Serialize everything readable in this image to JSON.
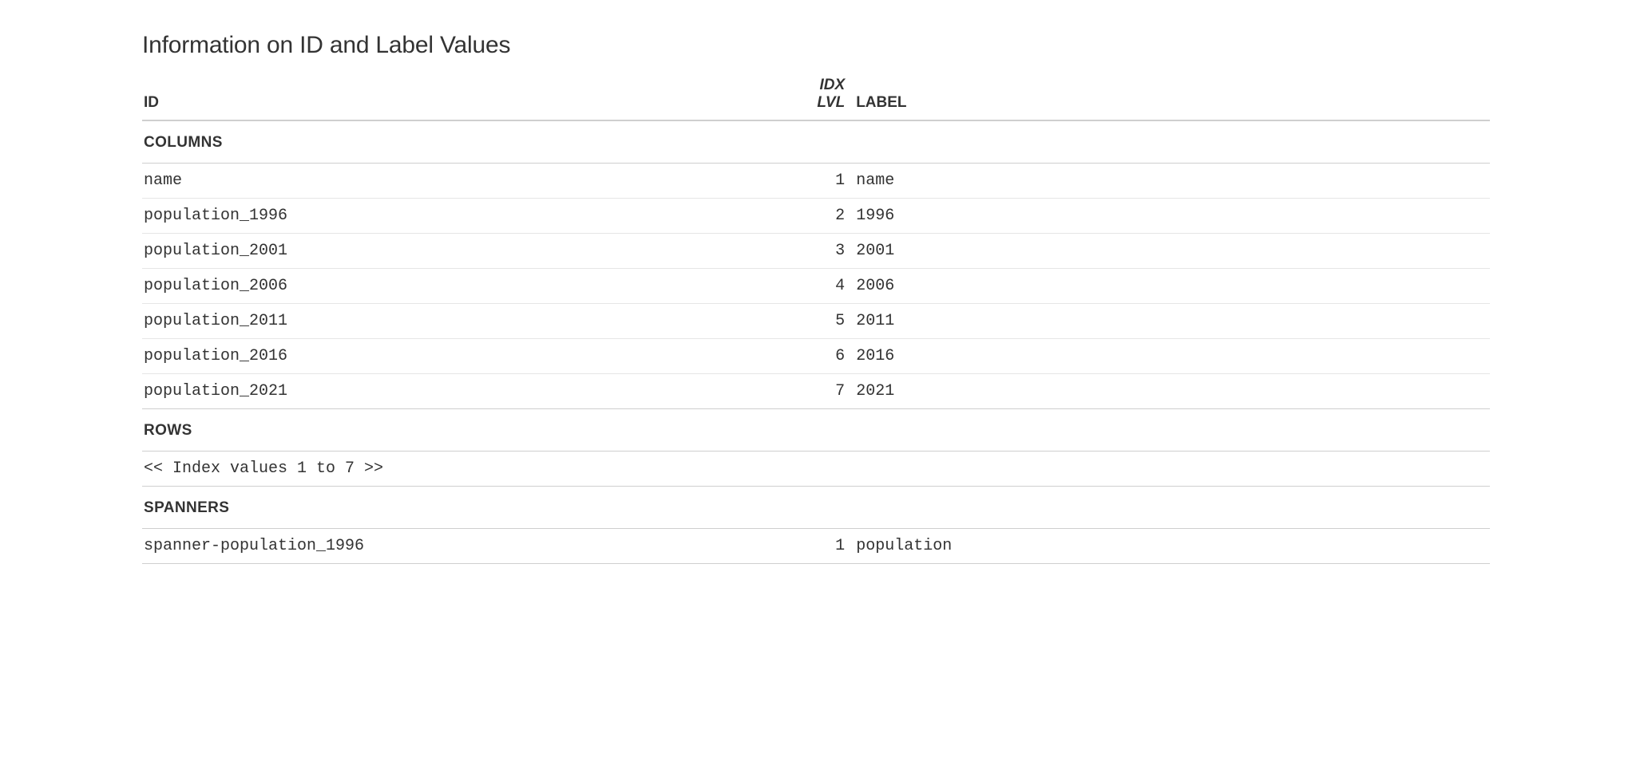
{
  "title": "Information on ID and Label Values",
  "headers": {
    "id": "ID",
    "idx_line1": "IDX",
    "idx_line2": "LVL",
    "label": "LABEL"
  },
  "groups": {
    "columns": "COLUMNS",
    "rows": "ROWS",
    "spanners": "SPANNERS"
  },
  "columns_rows": [
    {
      "id": "name",
      "idx": "1",
      "label": "name"
    },
    {
      "id": "population_1996",
      "idx": "2",
      "label": "1996"
    },
    {
      "id": "population_2001",
      "idx": "3",
      "label": "2001"
    },
    {
      "id": "population_2006",
      "idx": "4",
      "label": "2006"
    },
    {
      "id": "population_2011",
      "idx": "5",
      "label": "2011"
    },
    {
      "id": "population_2016",
      "idx": "6",
      "label": "2016"
    },
    {
      "id": "population_2021",
      "idx": "7",
      "label": "2021"
    }
  ],
  "rows_note": "<< Index values 1 to 7 >>",
  "spanners_rows": [
    {
      "id": "spanner-population_1996",
      "idx": "1",
      "label": "population"
    }
  ]
}
